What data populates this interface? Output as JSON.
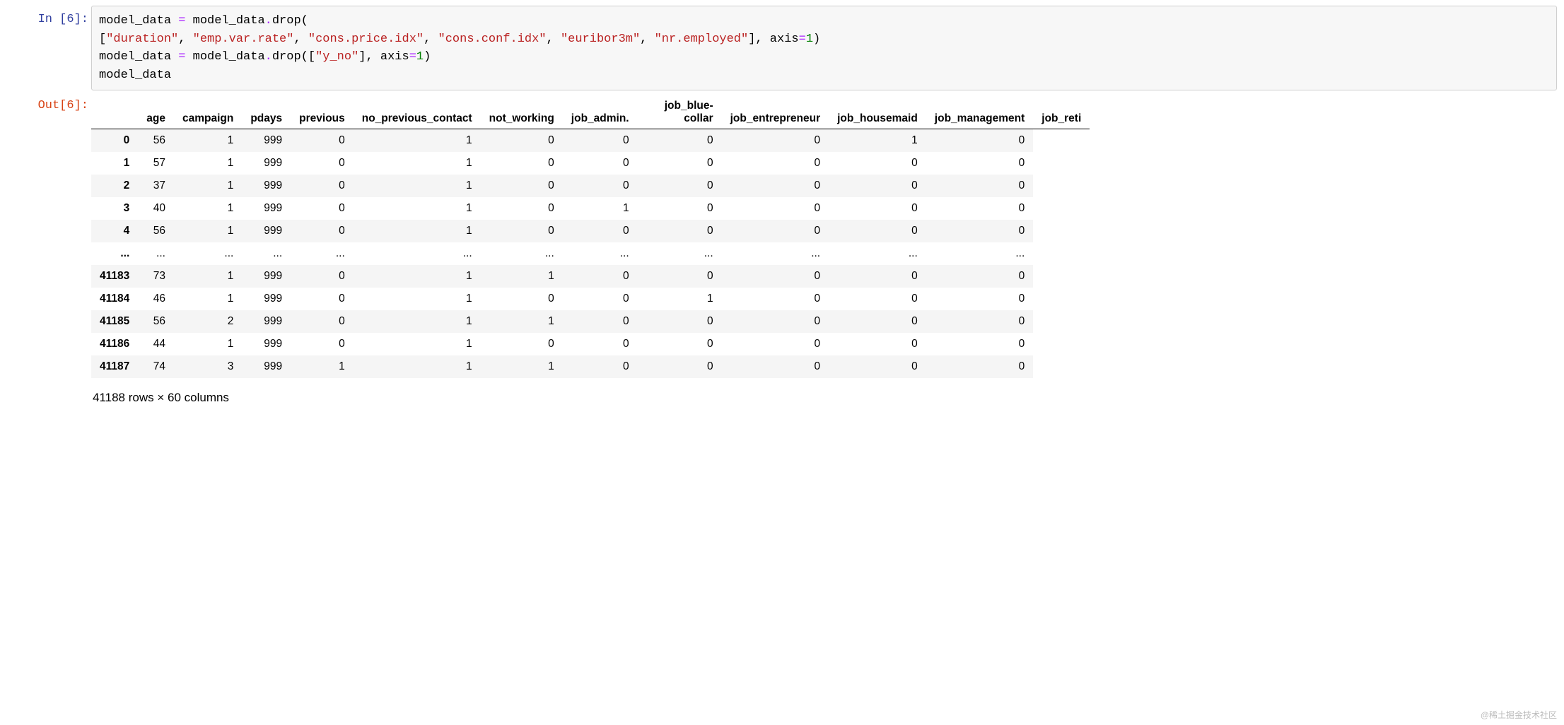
{
  "prompts": {
    "in": "In [6]:",
    "out": "Out[6]:"
  },
  "code": {
    "line1_a": "model_data ",
    "line1_op": "=",
    "line1_b": " model_data",
    "line1_dot": ".",
    "line1_c": "drop(",
    "line2_a": "[",
    "line2_s1": "\"duration\"",
    "line2_s2": "\"emp.var.rate\"",
    "line2_s3": "\"cons.price.idx\"",
    "line2_s4": "\"cons.conf.idx\"",
    "line2_s5": "\"euribor3m\"",
    "line2_s6": "\"nr.employed\"",
    "line2_b": "], axis",
    "line2_num": "1",
    "line2_c": ")",
    "line3_a": "model_data ",
    "line3_b": " model_data",
    "line3_c": "drop([",
    "line3_s1": "\"y_no\"",
    "line3_d": "], axis",
    "line3_e": ")",
    "line4": "model_data",
    "comma": ", "
  },
  "table": {
    "columns": [
      "age",
      "campaign",
      "pdays",
      "previous",
      "no_previous_contact",
      "not_working",
      "job_admin.",
      "job_blue-collar",
      "job_entrepreneur",
      "job_housemaid",
      "job_management",
      "job_reti"
    ],
    "rows": [
      {
        "idx": "0",
        "vals": [
          "56",
          "1",
          "999",
          "0",
          "1",
          "0",
          "0",
          "0",
          "0",
          "1",
          "0"
        ]
      },
      {
        "idx": "1",
        "vals": [
          "57",
          "1",
          "999",
          "0",
          "1",
          "0",
          "0",
          "0",
          "0",
          "0",
          "0"
        ]
      },
      {
        "idx": "2",
        "vals": [
          "37",
          "1",
          "999",
          "0",
          "1",
          "0",
          "0",
          "0",
          "0",
          "0",
          "0"
        ]
      },
      {
        "idx": "3",
        "vals": [
          "40",
          "1",
          "999",
          "0",
          "1",
          "0",
          "1",
          "0",
          "0",
          "0",
          "0"
        ]
      },
      {
        "idx": "4",
        "vals": [
          "56",
          "1",
          "999",
          "0",
          "1",
          "0",
          "0",
          "0",
          "0",
          "0",
          "0"
        ]
      },
      {
        "idx": "...",
        "vals": [
          "...",
          "...",
          "...",
          "...",
          "...",
          "...",
          "...",
          "...",
          "...",
          "...",
          "..."
        ]
      },
      {
        "idx": "41183",
        "vals": [
          "73",
          "1",
          "999",
          "0",
          "1",
          "1",
          "0",
          "0",
          "0",
          "0",
          "0"
        ]
      },
      {
        "idx": "41184",
        "vals": [
          "46",
          "1",
          "999",
          "0",
          "1",
          "0",
          "0",
          "1",
          "0",
          "0",
          "0"
        ]
      },
      {
        "idx": "41185",
        "vals": [
          "56",
          "2",
          "999",
          "0",
          "1",
          "1",
          "0",
          "0",
          "0",
          "0",
          "0"
        ]
      },
      {
        "idx": "41186",
        "vals": [
          "44",
          "1",
          "999",
          "0",
          "1",
          "0",
          "0",
          "0",
          "0",
          "0",
          "0"
        ]
      },
      {
        "idx": "41187",
        "vals": [
          "74",
          "3",
          "999",
          "1",
          "1",
          "1",
          "0",
          "0",
          "0",
          "0",
          "0"
        ]
      }
    ],
    "footer": "41188 rows × 60 columns"
  },
  "watermark": "@稀土掘金技术社区"
}
